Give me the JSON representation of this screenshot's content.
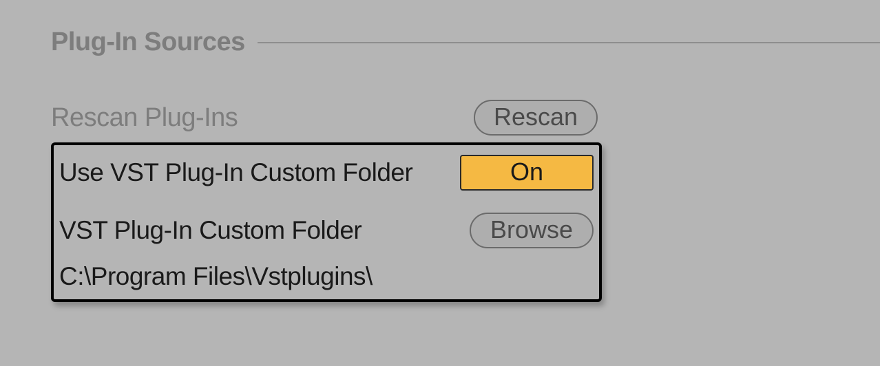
{
  "section": {
    "title": "Plug-In Sources"
  },
  "rescan": {
    "label": "Rescan Plug-Ins",
    "button": "Rescan"
  },
  "custom_folder": {
    "use_label": "Use VST Plug-In Custom Folder",
    "toggle_value": "On",
    "folder_label": "VST Plug-In Custom Folder",
    "browse_button": "Browse",
    "path": "C:\\Program Files\\Vstplugins\\"
  }
}
